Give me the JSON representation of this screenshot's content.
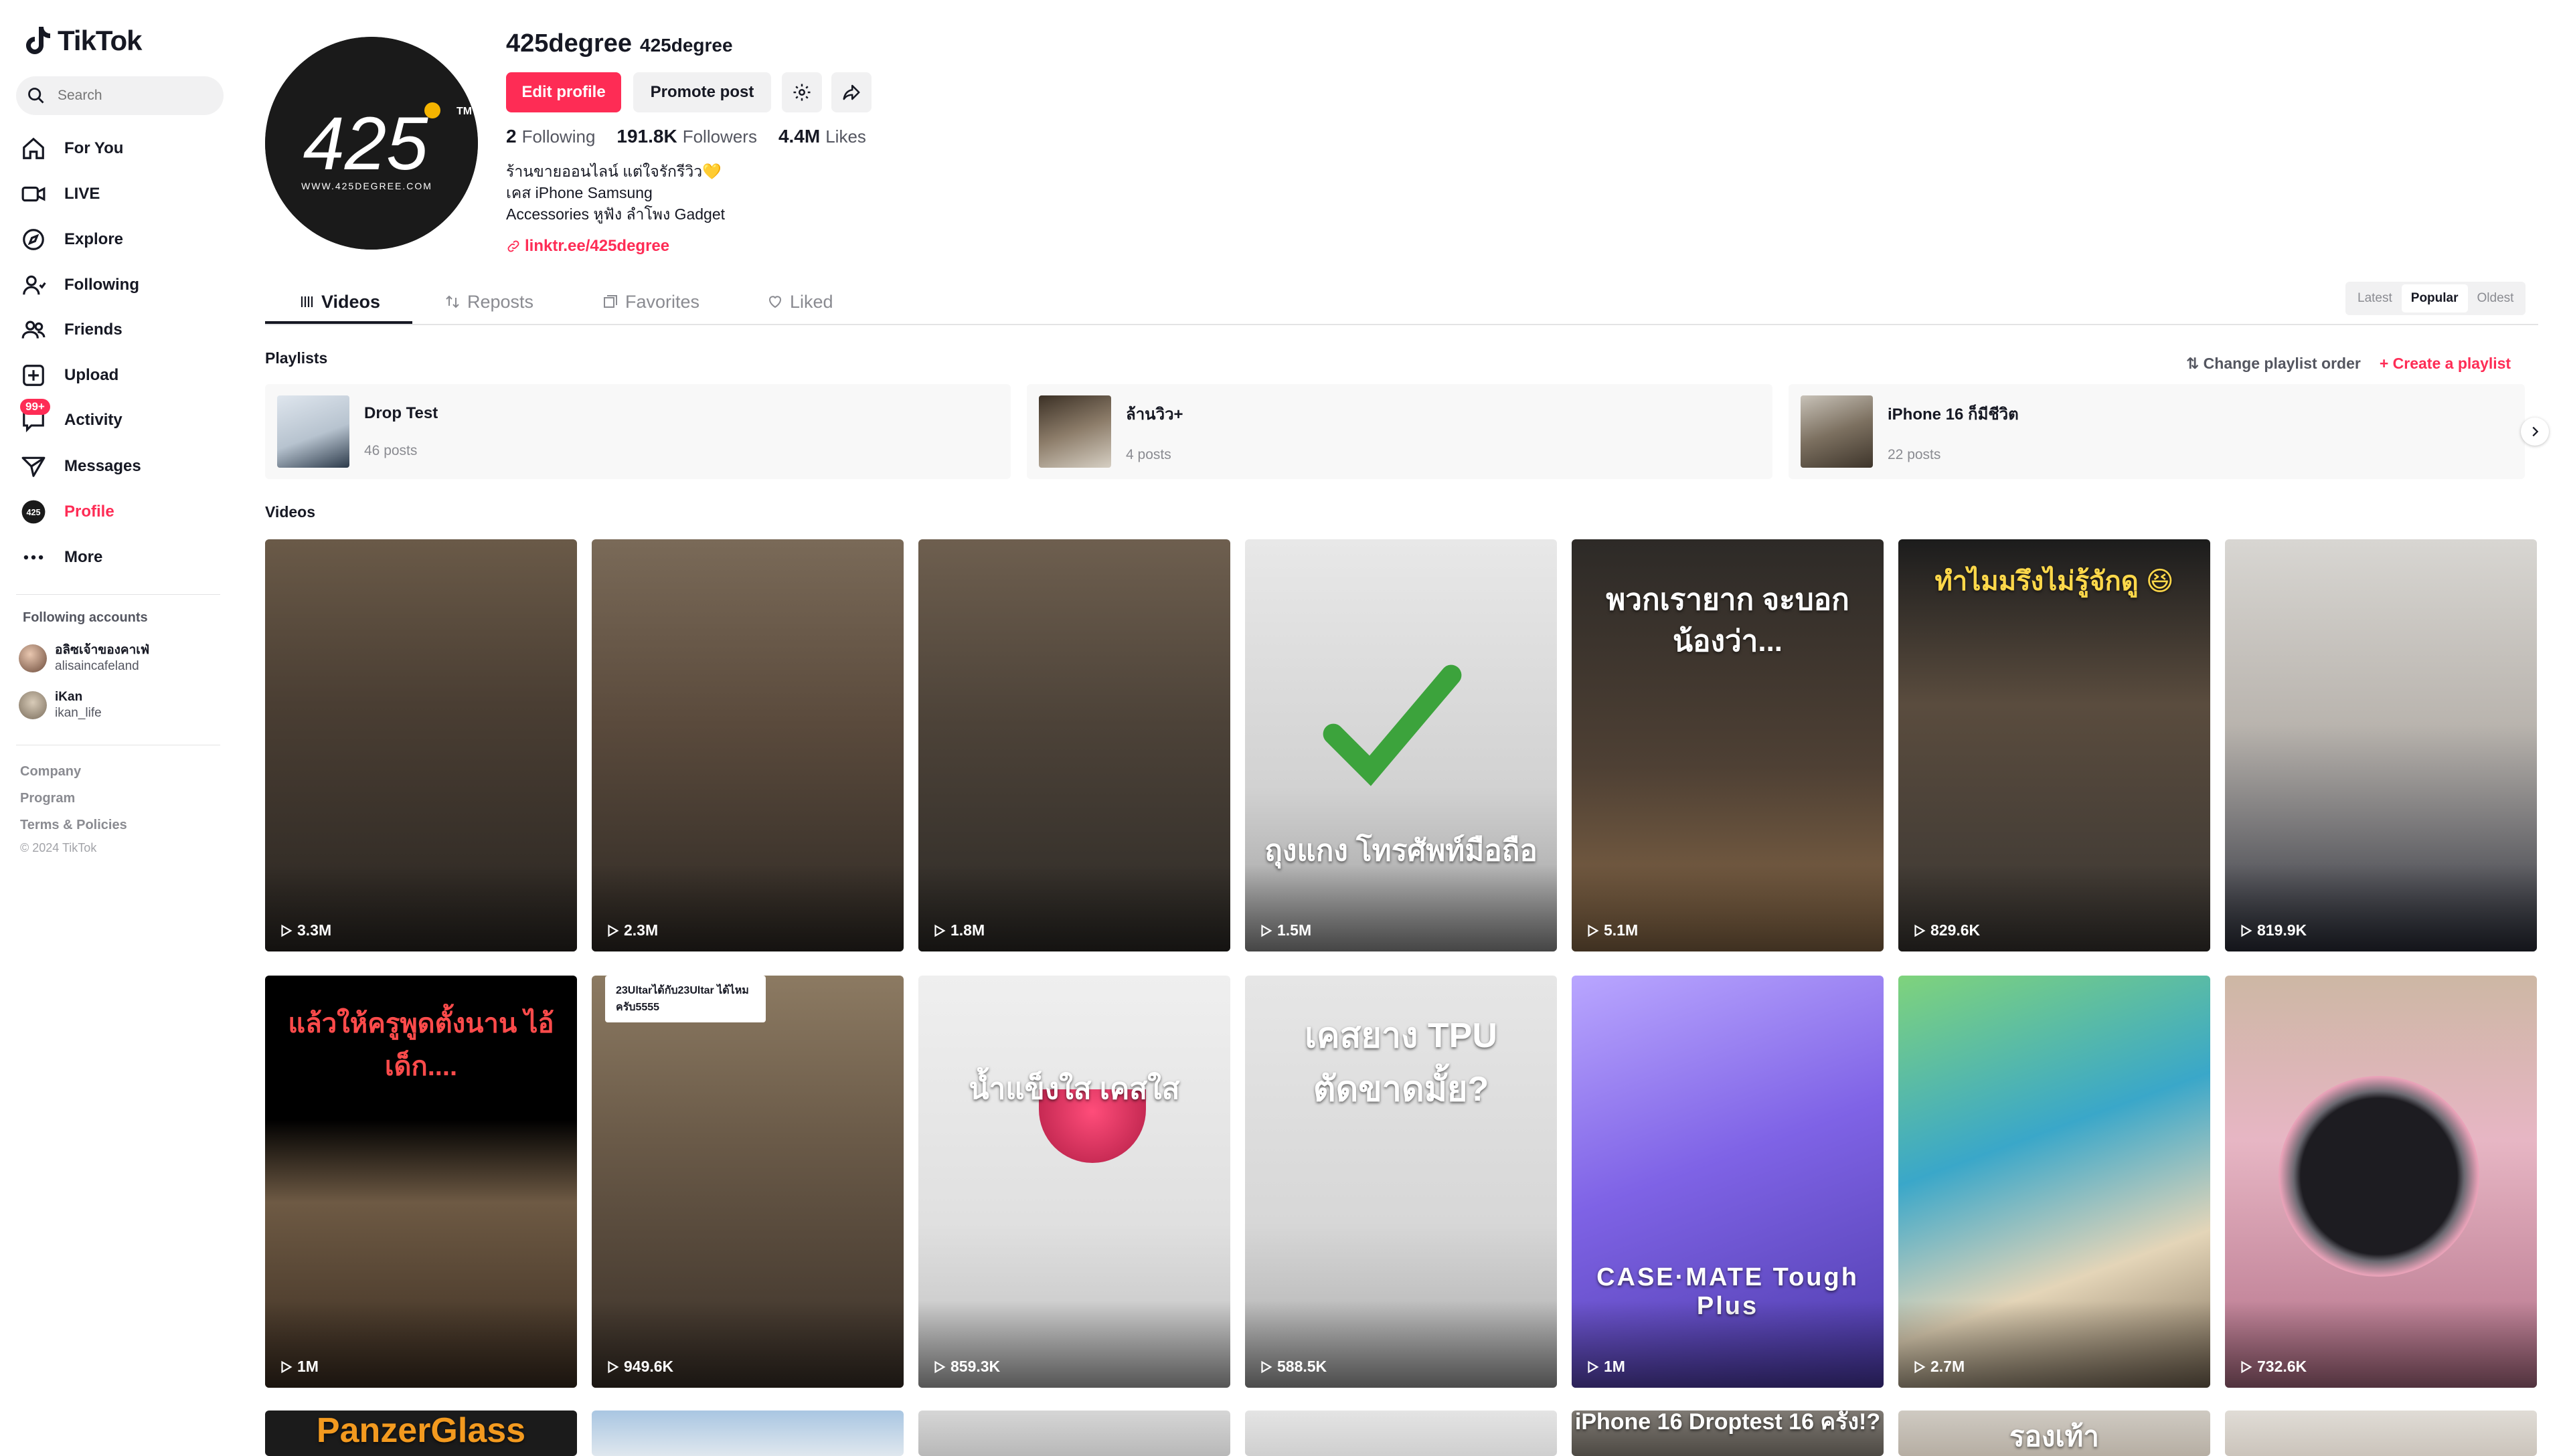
{
  "app": {
    "name": "TikTok"
  },
  "search": {
    "placeholder": "Search"
  },
  "nav": [
    {
      "label": "For You",
      "icon": "home-icon"
    },
    {
      "label": "LIVE",
      "icon": "live-icon"
    },
    {
      "label": "Explore",
      "icon": "compass-icon"
    },
    {
      "label": "Following",
      "icon": "user-follow-icon"
    },
    {
      "label": "Friends",
      "icon": "friends-icon"
    },
    {
      "label": "Upload",
      "icon": "upload-icon"
    },
    {
      "label": "Activity",
      "icon": "inbox-icon",
      "badge": "99+"
    },
    {
      "label": "Messages",
      "icon": "send-icon"
    },
    {
      "label": "Profile",
      "icon": "profile-avatar-icon"
    },
    {
      "label": "More",
      "icon": "more-icon"
    }
  ],
  "following": {
    "title": "Following accounts",
    "accounts": [
      {
        "name": "อลิซเจ้าของคาเฟ่",
        "handle": "alisaincafeland"
      },
      {
        "name": "iKan",
        "handle": "ikan_life"
      }
    ]
  },
  "footer": {
    "links": [
      "Company",
      "Program",
      "Terms & Policies"
    ],
    "copyright": "© 2024 TikTok"
  },
  "profile": {
    "username": "425degree",
    "nickname": "425degree",
    "edit_label": "Edit profile",
    "promote_label": "Promote post",
    "following_count": "2",
    "following_label": "Following",
    "followers_count": "191.8K",
    "followers_label": "Followers",
    "likes_count": "4.4M",
    "likes_label": "Likes",
    "bio": [
      "ร้านขายออนไลน์ แต่ใจรักรีวิว💛",
      "เคส iPhone Samsung",
      "Accessories หูฟัง ลำโพง Gadget"
    ],
    "link": "linktr.ee/425degree",
    "avatar_text": "425",
    "avatar_sub": "WWW.425DEGREE.COM"
  },
  "tabs": [
    {
      "label": "Videos",
      "icon": "grid-icon"
    },
    {
      "label": "Reposts",
      "icon": "repost-icon"
    },
    {
      "label": "Favorites",
      "icon": "bookmark-icon"
    },
    {
      "label": "Liked",
      "icon": "heart-icon"
    }
  ],
  "sort": {
    "options": [
      "Latest",
      "Popular",
      "Oldest"
    ],
    "selected": "Popular"
  },
  "playlists": {
    "title": "Playlists",
    "change_order": "Change playlist order",
    "create": "+ Create a playlist",
    "items": [
      {
        "name": "Drop Test",
        "posts": "46 posts"
      },
      {
        "name": "ล้านวิว+",
        "posts": "4 posts"
      },
      {
        "name": "iPhone 16 ก็มีชีวิต",
        "posts": "22 posts"
      }
    ]
  },
  "videos": {
    "title": "Videos",
    "items": [
      {
        "views": "3.3M",
        "caption": ""
      },
      {
        "views": "2.3M",
        "caption": ""
      },
      {
        "views": "1.8M",
        "caption": ""
      },
      {
        "views": "1.5M",
        "caption": "ถุงแกง โทรศัพท์มือถือ"
      },
      {
        "views": "5.1M",
        "caption": "พวกเรายาก จะบอกน้องว่า..."
      },
      {
        "views": "829.6K",
        "caption": "ทำไมมรึงไม่รู้จักดู 😆"
      },
      {
        "views": "819.9K",
        "caption": ""
      },
      {
        "views": "1M",
        "caption": "แล้วให้ครูพูดตั้งนาน ไอ้เด็ก...."
      },
      {
        "views": "949.6K",
        "caption": "23Ultarได้กับ23Ultar ได้ไหมครับ5555"
      },
      {
        "views": "859.3K",
        "caption": "น้ำแข็งใส เคสใส"
      },
      {
        "views": "588.5K",
        "caption": "เคสยาง TPU ตัดขาดมั้ย?"
      },
      {
        "views": "1M",
        "caption": "CASE·MATE Tough Plus"
      },
      {
        "views": "2.7M",
        "caption": ""
      },
      {
        "views": "732.6K",
        "caption": ""
      },
      {
        "views": "",
        "caption": "PanzerGlass"
      },
      {
        "views": "",
        "caption": ""
      },
      {
        "views": "",
        "caption": ""
      },
      {
        "views": "",
        "caption": ""
      },
      {
        "views": "",
        "caption": "iPhone 16 Droptest 16 ครั้ง!?"
      },
      {
        "views": "",
        "caption": "รองเท้า"
      },
      {
        "views": "",
        "caption": ""
      }
    ]
  },
  "colors": {
    "accent": "#fe2c55",
    "text": "#161823",
    "muted": "#8a8b91"
  }
}
